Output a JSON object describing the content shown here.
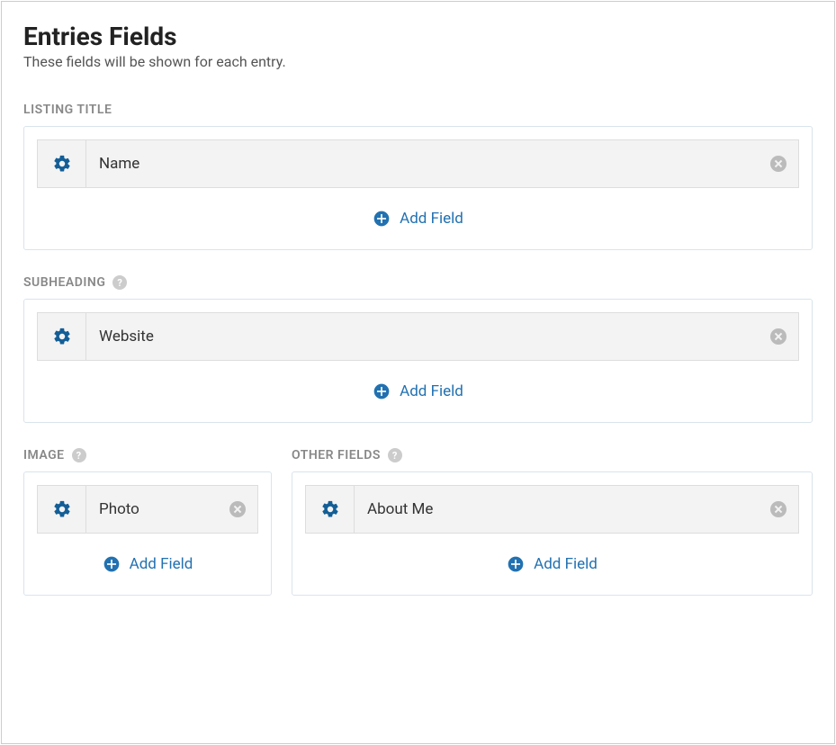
{
  "header": {
    "title": "Entries Fields",
    "subtitle": "These fields will be shown for each entry."
  },
  "addFieldLabel": "Add Field",
  "sections": {
    "listingTitle": {
      "label": "LISTING TITLE",
      "hasHelp": false,
      "field": "Name"
    },
    "subheading": {
      "label": "SUBHEADING",
      "hasHelp": true,
      "field": "Website"
    },
    "image": {
      "label": "IMAGE",
      "hasHelp": true,
      "field": "Photo"
    },
    "otherFields": {
      "label": "OTHER FIELDS",
      "hasHelp": true,
      "field": "About Me"
    }
  }
}
